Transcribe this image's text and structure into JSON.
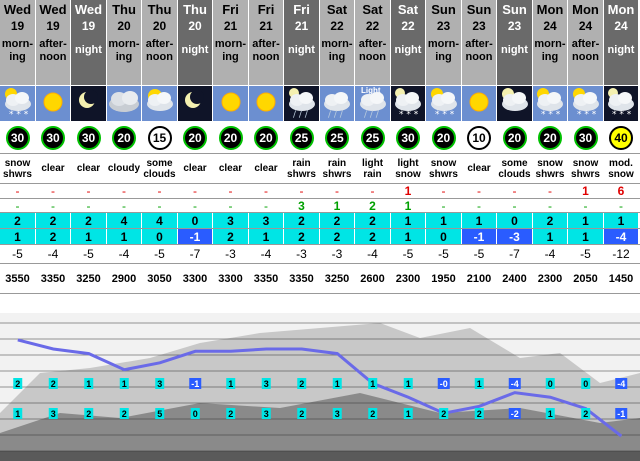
{
  "columns": [
    {
      "day": "Wed",
      "date": "19",
      "period": "morn-\ning",
      "sky": "snow",
      "wind": "30",
      "wstyle": "black",
      "cond": "snow shwrs",
      "rain": "-",
      "snow": "-",
      "frz1": "2",
      "frz2": "1",
      "temp": "-5",
      "alt": "3550"
    },
    {
      "day": "Wed",
      "date": "19",
      "period": "after-\nnoon",
      "sky": "sun",
      "wind": "30",
      "wstyle": "black",
      "cond": "clear",
      "rain": "-",
      "snow": "-",
      "frz1": "2",
      "frz2": "2",
      "temp": "-4",
      "alt": "3350"
    },
    {
      "day": "Wed",
      "date": "19",
      "period": "night",
      "sky": "moon",
      "wind": "30",
      "wstyle": "black",
      "cond": "clear",
      "rain": "-",
      "snow": "-",
      "frz1": "2",
      "frz2": "1",
      "temp": "-5",
      "alt": "3250"
    },
    {
      "day": "Thu",
      "date": "20",
      "period": "morn-\ning",
      "sky": "cloud",
      "wind": "20",
      "wstyle": "black",
      "cond": "cloudy",
      "rain": "-",
      "snow": "-",
      "frz1": "4",
      "frz2": "1",
      "temp": "-4",
      "alt": "2900"
    },
    {
      "day": "Thu",
      "date": "20",
      "period": "after-\nnoon",
      "sky": "partsun",
      "wind": "15",
      "wstyle": "white",
      "cond": "some clouds",
      "rain": "-",
      "snow": "-",
      "frz1": "4",
      "frz2": "0",
      "temp": "-5",
      "alt": "3050"
    },
    {
      "day": "Thu",
      "date": "20",
      "period": "night",
      "sky": "moon",
      "wind": "20",
      "wstyle": "black",
      "cond": "clear",
      "rain": "-",
      "snow": "-",
      "frz1": "0",
      "frz2": "-1",
      "temp": "-7",
      "alt": "3300"
    },
    {
      "day": "Fri",
      "date": "21",
      "period": "morn-\ning",
      "sky": "sun",
      "wind": "20",
      "wstyle": "black",
      "cond": "clear",
      "rain": "-",
      "snow": "-",
      "frz1": "3",
      "frz2": "2",
      "temp": "-3",
      "alt": "3300"
    },
    {
      "day": "Fri",
      "date": "21",
      "period": "after-\nnoon",
      "sky": "sun",
      "wind": "20",
      "wstyle": "black",
      "cond": "clear",
      "rain": "-",
      "snow": "-",
      "frz1": "3",
      "frz2": "1",
      "temp": "-4",
      "alt": "3350"
    },
    {
      "day": "Fri",
      "date": "21",
      "period": "night",
      "sky": "rainnight",
      "wind": "25",
      "wstyle": "black",
      "cond": "rain shwrs",
      "rain": "-",
      "snow": "3",
      "frz1": "2",
      "frz2": "2",
      "temp": "-3",
      "alt": "3350"
    },
    {
      "day": "Sat",
      "date": "22",
      "period": "morn-\ning",
      "sky": "rain",
      "wind": "25",
      "wstyle": "black",
      "cond": "rain shwrs",
      "rain": "-",
      "snow": "1",
      "frz1": "2",
      "frz2": "2",
      "temp": "-3",
      "alt": "3250"
    },
    {
      "day": "Sat",
      "date": "22",
      "period": "after-\nnoon",
      "sky": "lightrain",
      "wind": "25",
      "wstyle": "black",
      "cond": "light rain",
      "rain": "-",
      "snow": "2",
      "frz1": "2",
      "frz2": "2",
      "temp": "-4",
      "alt": "2600"
    },
    {
      "day": "Sat",
      "date": "22",
      "period": "night",
      "sky": "snownight",
      "wind": "30",
      "wstyle": "black",
      "cond": "light snow",
      "rain": "1",
      "snow": "1",
      "frz1": "1",
      "frz2": "1",
      "temp": "-5",
      "alt": "2300"
    },
    {
      "day": "Sun",
      "date": "23",
      "period": "morn-\ning",
      "sky": "snow",
      "wind": "20",
      "wstyle": "black",
      "cond": "snow shwrs",
      "rain": "-",
      "snow": "-",
      "frz1": "1",
      "frz2": "0",
      "temp": "-5",
      "alt": "1950"
    },
    {
      "day": "Sun",
      "date": "23",
      "period": "after-\nnoon",
      "sky": "sun",
      "wind": "10",
      "wstyle": "white",
      "cond": "clear",
      "rain": "-",
      "snow": "-",
      "frz1": "1",
      "frz2": "-1",
      "temp": "-5",
      "alt": "2100"
    },
    {
      "day": "Sun",
      "date": "23",
      "period": "night",
      "sky": "cloudnight",
      "wind": "20",
      "wstyle": "black",
      "cond": "some clouds",
      "rain": "-",
      "snow": "-",
      "frz1": "0",
      "frz2": "-3",
      "temp": "-7",
      "alt": "2400"
    },
    {
      "day": "Mon",
      "date": "24",
      "period": "morn-\ning",
      "sky": "snow",
      "wind": "20",
      "wstyle": "black",
      "cond": "snow shwrs",
      "rain": "-",
      "snow": "-",
      "frz1": "2",
      "frz2": "1",
      "temp": "-4",
      "alt": "2300"
    },
    {
      "day": "Mon",
      "date": "24",
      "period": "after-\nnoon",
      "sky": "snow",
      "wind": "30",
      "wstyle": "black",
      "cond": "snow shwrs",
      "rain": "1",
      "snow": "-",
      "frz1": "1",
      "frz2": "1",
      "temp": "-5",
      "alt": "2050"
    },
    {
      "day": "Mon",
      "date": "24",
      "period": "night",
      "sky": "snownight",
      "wind": "40",
      "wstyle": "yellow",
      "cond": "mod. snow",
      "rain": "6",
      "snow": "-",
      "frz1": "1",
      "frz2": "-4",
      "temp": "-12",
      "alt": "1450"
    }
  ],
  "chart_data": {
    "type": "line",
    "x": [
      "Wed 19 morning",
      "Wed 19 afternoon",
      "Wed 19 night",
      "Thu 20 morning",
      "Thu 20 afternoon",
      "Thu 20 night",
      "Fri 21 morning",
      "Fri 21 afternoon",
      "Fri 21 night",
      "Sat 22 morning",
      "Sat 22 afternoon",
      "Sat 22 night",
      "Sun 23 morning",
      "Sun 23 afternoon",
      "Sun 23 night",
      "Mon 24 morning",
      "Mon 24 afternoon",
      "Mon 24 night"
    ],
    "series": [
      {
        "values": [
          3550,
          3350,
          3250,
          2900,
          3050,
          3300,
          3300,
          3350,
          3350,
          3250,
          2600,
          2300,
          1950,
          2100,
          2400,
          2300,
          2050,
          1450
        ],
        "color": "#6a6ae8"
      }
    ],
    "labels_row1": [
      "2",
      "2",
      "1",
      "1",
      "3",
      "-1",
      "1",
      "3",
      "2",
      "1",
      "1",
      "1",
      "-0",
      "1",
      "-4",
      "0",
      "0",
      "-4"
    ],
    "labels_row2": [
      "1",
      "3",
      "2",
      "2",
      "5",
      "0",
      "2",
      "3",
      "2",
      "3",
      "2",
      "1",
      "2",
      "2",
      "-2",
      "1",
      "2",
      "-1"
    ],
    "ylim": [
      1000,
      4000
    ]
  },
  "colors": {
    "freeze": "#00e5e5",
    "freeze_negative": "#2a5cff",
    "line": "#6a6ae8"
  }
}
